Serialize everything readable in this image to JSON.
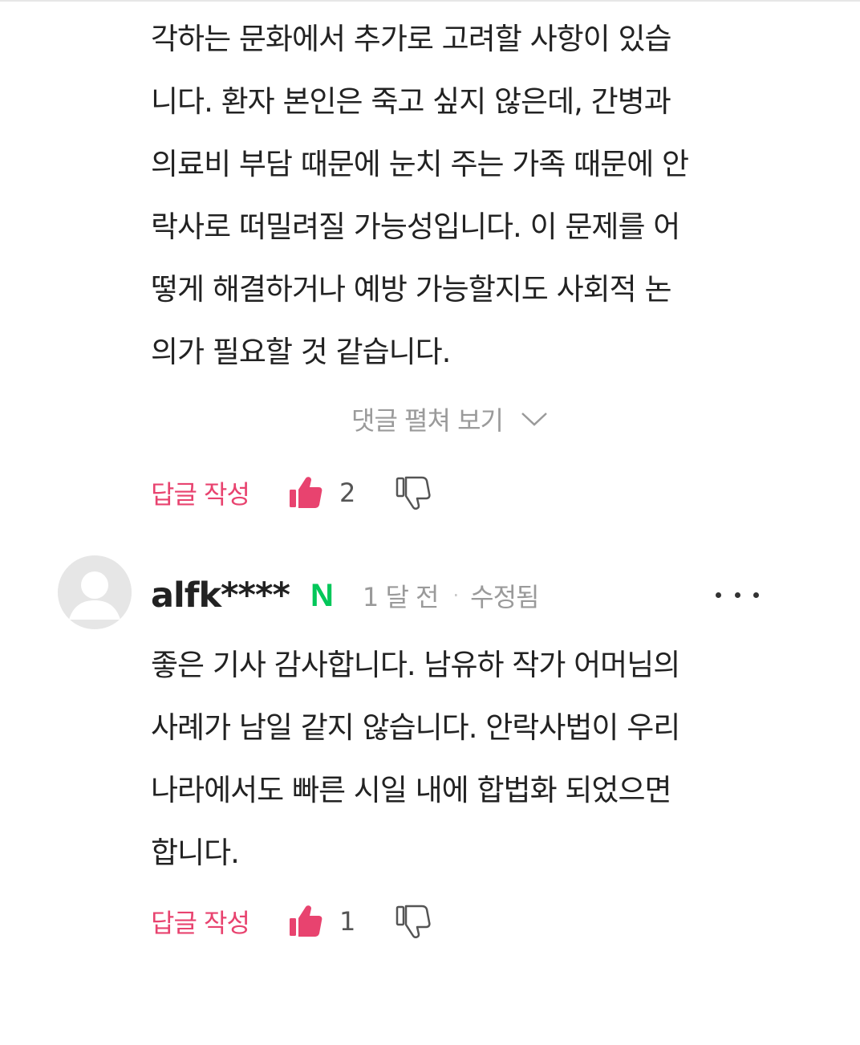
{
  "comment1": {
    "lines": [
      "각하는 문화에서 추가로 고려할 사항이 있습",
      "니다. 환자 본인은 죽고 싶지 않은데, 간병과",
      "의료비 부담 때문에 눈치 주는 가족 때문에 안",
      "락사로 떠밀려질 가능성입니다. 이 문제를 어",
      "떻게 해결하거나 예방 가능할지도 사회적 논",
      "의가 필요할 것 같습니다."
    ],
    "expand_label": "댓글 펼쳐 보기",
    "reply_label": "답글 작성",
    "like_count": "2"
  },
  "comment2": {
    "username": "alfk****",
    "badge": "N",
    "time": "1 달 전",
    "separator": "·",
    "edited": "수정됨",
    "lines": [
      "좋은 기사 감사합니다. 남유하 작가 어머님의",
      "사례가 남일 같지 않습니다. 안락사법이 우리",
      "나라에서도 빠른 시일 내에 합법화 되었으면",
      "합니다."
    ],
    "reply_label": "답글 작성",
    "like_count": "1"
  },
  "colors": {
    "accent": "#e8436f",
    "naver_green": "#03c75a",
    "muted": "#9a9a9a",
    "text": "#222222"
  },
  "icons": {
    "like": "thumbs-up-filled-icon",
    "dislike": "thumbs-down-outline-icon",
    "expand": "chevron-down-icon",
    "more": "more-horizontal-icon",
    "avatar": "default-user-avatar"
  }
}
